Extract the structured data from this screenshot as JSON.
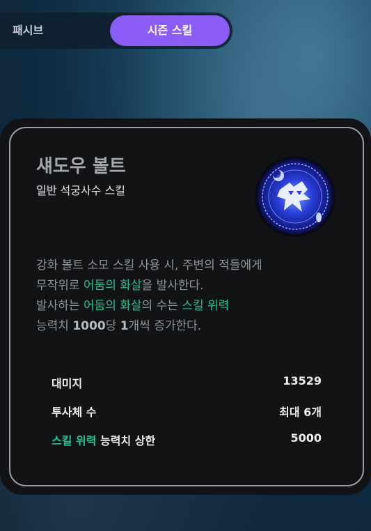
{
  "tabs": {
    "passive_label": "패시브",
    "season_skill_label": "시즌 스킬",
    "active_tab_color": "#8b5cf6"
  },
  "skill": {
    "name": "섀도우 볼트",
    "grade": "일반",
    "class_skill": "석궁사수 스킬",
    "icon": "shadow-bolt-icon",
    "description": {
      "line1": "강화 볼트 소모 스킬 사용 시, 주변의 적들에게",
      "line2_a": "무작위로 ",
      "line2_hl": "어둠의 화살",
      "line2_b": "을 발사한다.",
      "line3_a": "발사하는 ",
      "line3_hl1": "어둠의 화살",
      "line3_b": "의 수는 ",
      "line3_hl2": "스킬 위력",
      "line4_a": "능력치 ",
      "line4_b1": "1000",
      "line4_c": "당 ",
      "line4_b2": "1",
      "line4_d": "개씩 증가한다."
    },
    "highlight_color": "#1fc294"
  },
  "stats": [
    {
      "label": "대미지",
      "value": "13529"
    },
    {
      "label": "투사체 수",
      "value": "최대 6개"
    },
    {
      "label_hl": "스킬 위력",
      "label": " 능력치 상한",
      "value": "5000"
    }
  ]
}
